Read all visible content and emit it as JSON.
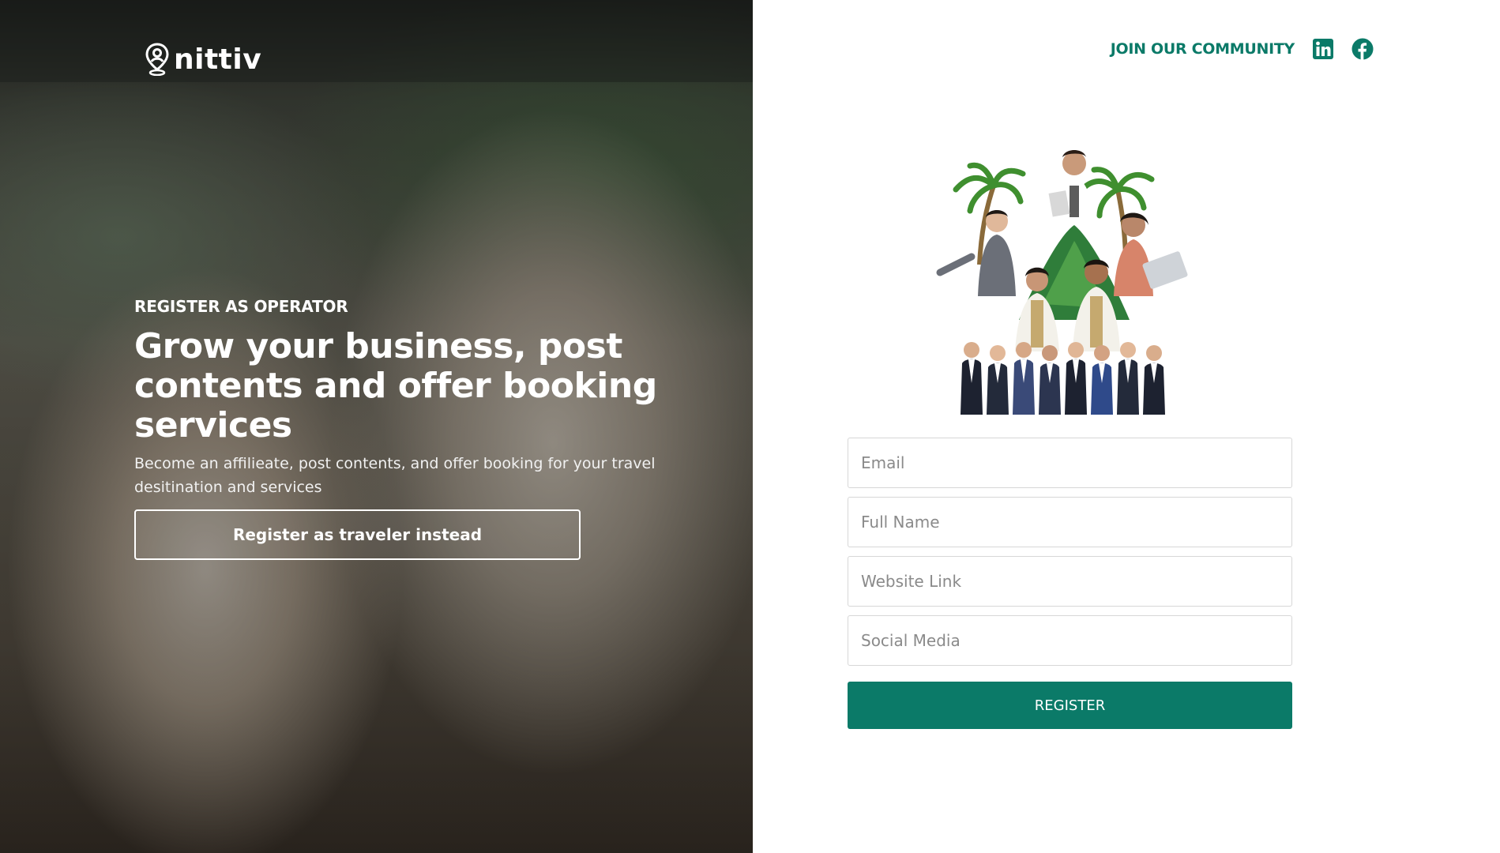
{
  "brand": {
    "name": "nittiv",
    "logo_icon": "location-pin-person-icon"
  },
  "hero": {
    "eyebrow": "REGISTER AS OPERATOR",
    "headline": "Grow your business, post contents and offer booking services",
    "subtext": "Become an affilieate, post contents, and offer booking for your travel desitination and services",
    "traveler_button_label": "Register as traveler instead",
    "background_image": "smiling-hotel-staff-greeting-photo"
  },
  "topnav": {
    "community_label": "JOIN OUR COMMUNITY",
    "social_icons": [
      "linkedin-icon",
      "facebook-icon"
    ]
  },
  "illustration": {
    "description_icon": "team-collage-illustration"
  },
  "form": {
    "email_placeholder": "Email",
    "fullname_placeholder": "Full Name",
    "website_placeholder": "Website Link",
    "social_placeholder": "Social Media",
    "submit_label": "REGISTER"
  },
  "colors": {
    "accent": "#0b7a68",
    "input_border": "#d7d7d7",
    "placeholder": "#8a8a8a"
  }
}
